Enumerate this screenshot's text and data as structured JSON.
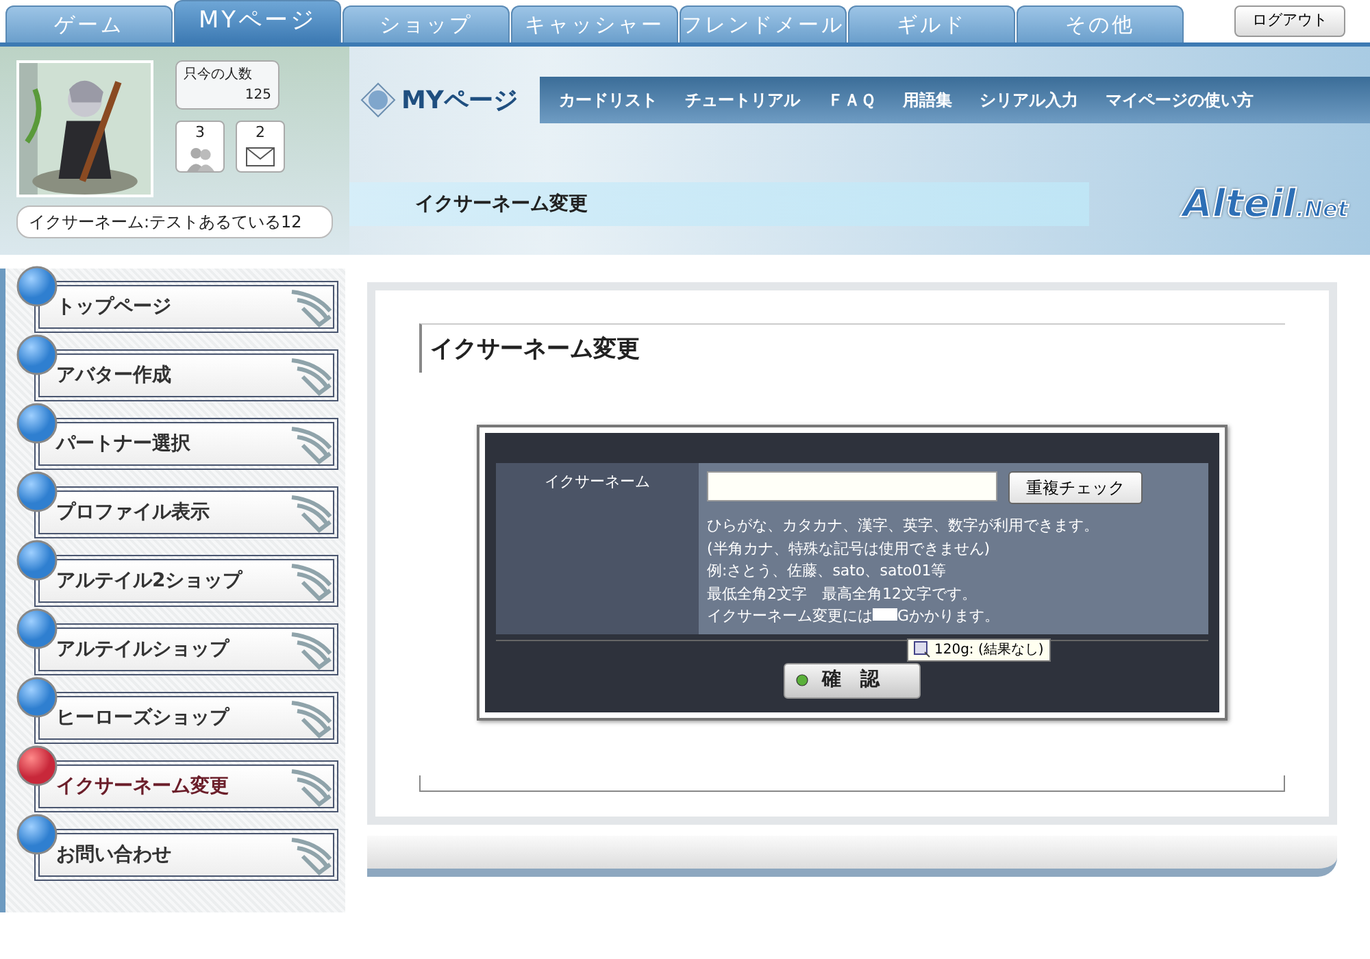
{
  "tabs": [
    {
      "label": "ゲーム",
      "selected": false
    },
    {
      "label": "MYページ",
      "selected": true
    },
    {
      "label": "ショップ",
      "selected": false
    },
    {
      "label": "キャッシャー",
      "selected": false
    },
    {
      "label": "フレンドメール",
      "selected": false
    },
    {
      "label": "ギルド",
      "selected": false
    },
    {
      "label": "その他",
      "selected": false
    }
  ],
  "logout": "ログアウト",
  "profile": {
    "online_label": "只今の人数",
    "online_count": "125",
    "friends_count": "3",
    "mail_count": "2",
    "name": "イクサーネーム:テストあるている12"
  },
  "page_logo": "MYページ",
  "nav_links": [
    "カードリスト",
    "チュートリアル",
    "ＦＡＱ",
    "用語集",
    "シリアル入力",
    "マイページの使い方"
  ],
  "breadcrumb": "イクサーネーム変更",
  "site_logo": {
    "main": "Alteil",
    "sub": ".Net"
  },
  "sidebar": [
    {
      "label": "トップページ",
      "selected": false
    },
    {
      "label": "アバター作成",
      "selected": false
    },
    {
      "label": "パートナー選択",
      "selected": false
    },
    {
      "label": "プロファイル表示",
      "selected": false
    },
    {
      "label": "アルテイル2ショップ",
      "selected": false
    },
    {
      "label": "アルテイルショップ",
      "selected": false
    },
    {
      "label": "ヒーローズショップ",
      "selected": false
    },
    {
      "label": "イクサーネーム変更",
      "selected": true
    },
    {
      "label": "お問い合わせ",
      "selected": false
    }
  ],
  "content": {
    "title": "イクサーネーム変更",
    "field_label": "イクサーネーム",
    "check_button": "重複チェック",
    "notes": [
      "ひらがな、カタカナ、漢字、英字、数字が利用できます。",
      "(半角カナ、特殊な記号は使用できません)",
      "例:さとう、佐藤、sato、sato01等",
      "最低全角2文字　最高全角12文字です。"
    ],
    "cost_note": {
      "before": "イクサーネーム変更には",
      "after": "Gかかります。"
    },
    "tooltip": "120g: (結果なし)",
    "confirm_button": "確　認"
  }
}
